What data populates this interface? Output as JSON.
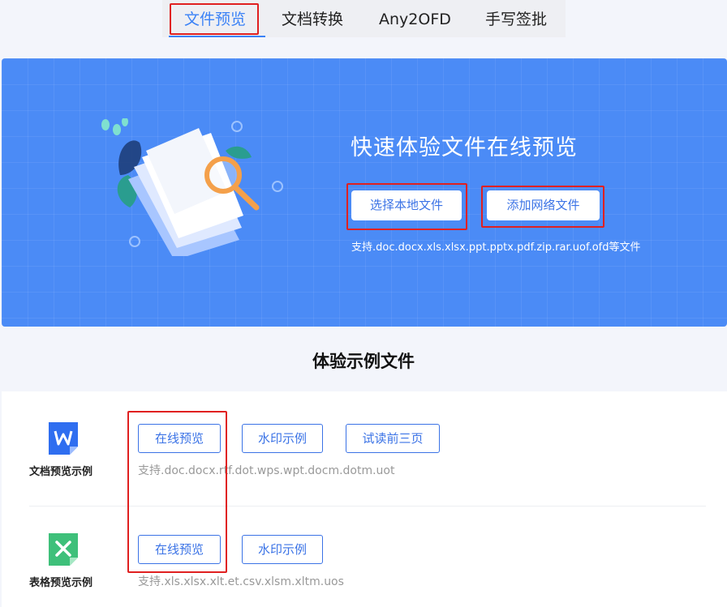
{
  "tabs": [
    {
      "label": "文件预览",
      "active": true
    },
    {
      "label": "文档转换",
      "active": false
    },
    {
      "label": "Any2OFD",
      "active": false
    },
    {
      "label": "手写签批",
      "active": false
    }
  ],
  "hero": {
    "title": "快速体验文件在线预览",
    "select_local_label": "选择本地文件",
    "add_network_label": "添加网络文件",
    "support_text": "支持.doc.docx.xls.xlsx.ppt.pptx.pdf.zip.rar.uof.ofd等文件"
  },
  "samples": {
    "title": "体验示例文件",
    "doc": {
      "label": "文档预览示例",
      "icon": "word-doc-icon",
      "buttons": [
        "在线预览",
        "水印示例",
        "试读前三页"
      ],
      "support_text": "支持.doc.docx.rtf.dot.wps.wpt.docm.dotm.uot"
    },
    "sheet": {
      "label": "表格预览示例",
      "icon": "excel-sheet-icon",
      "buttons": [
        "在线预览",
        "水印示例"
      ],
      "support_text": "支持.xls.xlsx.xlt.et.csv.xlsm.xltm.uos"
    }
  },
  "colors": {
    "accent": "#3b82f6",
    "hero_bg": "#4b8bf6",
    "highlight_box": "#e02020",
    "doc_icon": "#2f6ef0",
    "sheet_icon": "#3ec07a"
  }
}
